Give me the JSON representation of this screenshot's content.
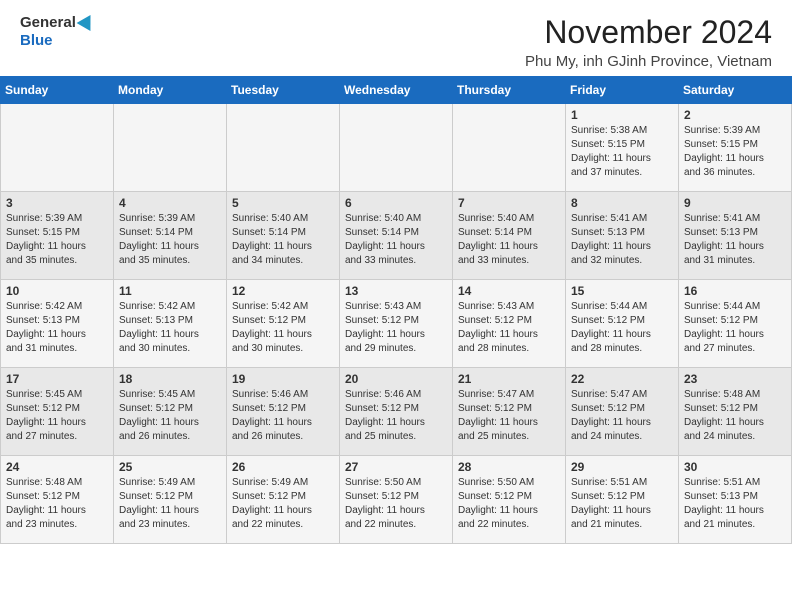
{
  "header": {
    "logo_general": "General",
    "logo_blue": "Blue",
    "month_title": "November 2024",
    "location": "Phu My, inh GJinh Province, Vietnam"
  },
  "calendar": {
    "days_of_week": [
      "Sunday",
      "Monday",
      "Tuesday",
      "Wednesday",
      "Thursday",
      "Friday",
      "Saturday"
    ],
    "weeks": [
      [
        {
          "day": "",
          "info": ""
        },
        {
          "day": "",
          "info": ""
        },
        {
          "day": "",
          "info": ""
        },
        {
          "day": "",
          "info": ""
        },
        {
          "day": "",
          "info": ""
        },
        {
          "day": "1",
          "info": "Sunrise: 5:38 AM\nSunset: 5:15 PM\nDaylight: 11 hours\nand 37 minutes."
        },
        {
          "day": "2",
          "info": "Sunrise: 5:39 AM\nSunset: 5:15 PM\nDaylight: 11 hours\nand 36 minutes."
        }
      ],
      [
        {
          "day": "3",
          "info": "Sunrise: 5:39 AM\nSunset: 5:15 PM\nDaylight: 11 hours\nand 35 minutes."
        },
        {
          "day": "4",
          "info": "Sunrise: 5:39 AM\nSunset: 5:14 PM\nDaylight: 11 hours\nand 35 minutes."
        },
        {
          "day": "5",
          "info": "Sunrise: 5:40 AM\nSunset: 5:14 PM\nDaylight: 11 hours\nand 34 minutes."
        },
        {
          "day": "6",
          "info": "Sunrise: 5:40 AM\nSunset: 5:14 PM\nDaylight: 11 hours\nand 33 minutes."
        },
        {
          "day": "7",
          "info": "Sunrise: 5:40 AM\nSunset: 5:14 PM\nDaylight: 11 hours\nand 33 minutes."
        },
        {
          "day": "8",
          "info": "Sunrise: 5:41 AM\nSunset: 5:13 PM\nDaylight: 11 hours\nand 32 minutes."
        },
        {
          "day": "9",
          "info": "Sunrise: 5:41 AM\nSunset: 5:13 PM\nDaylight: 11 hours\nand 31 minutes."
        }
      ],
      [
        {
          "day": "10",
          "info": "Sunrise: 5:42 AM\nSunset: 5:13 PM\nDaylight: 11 hours\nand 31 minutes."
        },
        {
          "day": "11",
          "info": "Sunrise: 5:42 AM\nSunset: 5:13 PM\nDaylight: 11 hours\nand 30 minutes."
        },
        {
          "day": "12",
          "info": "Sunrise: 5:42 AM\nSunset: 5:12 PM\nDaylight: 11 hours\nand 30 minutes."
        },
        {
          "day": "13",
          "info": "Sunrise: 5:43 AM\nSunset: 5:12 PM\nDaylight: 11 hours\nand 29 minutes."
        },
        {
          "day": "14",
          "info": "Sunrise: 5:43 AM\nSunset: 5:12 PM\nDaylight: 11 hours\nand 28 minutes."
        },
        {
          "day": "15",
          "info": "Sunrise: 5:44 AM\nSunset: 5:12 PM\nDaylight: 11 hours\nand 28 minutes."
        },
        {
          "day": "16",
          "info": "Sunrise: 5:44 AM\nSunset: 5:12 PM\nDaylight: 11 hours\nand 27 minutes."
        }
      ],
      [
        {
          "day": "17",
          "info": "Sunrise: 5:45 AM\nSunset: 5:12 PM\nDaylight: 11 hours\nand 27 minutes."
        },
        {
          "day": "18",
          "info": "Sunrise: 5:45 AM\nSunset: 5:12 PM\nDaylight: 11 hours\nand 26 minutes."
        },
        {
          "day": "19",
          "info": "Sunrise: 5:46 AM\nSunset: 5:12 PM\nDaylight: 11 hours\nand 26 minutes."
        },
        {
          "day": "20",
          "info": "Sunrise: 5:46 AM\nSunset: 5:12 PM\nDaylight: 11 hours\nand 25 minutes."
        },
        {
          "day": "21",
          "info": "Sunrise: 5:47 AM\nSunset: 5:12 PM\nDaylight: 11 hours\nand 25 minutes."
        },
        {
          "day": "22",
          "info": "Sunrise: 5:47 AM\nSunset: 5:12 PM\nDaylight: 11 hours\nand 24 minutes."
        },
        {
          "day": "23",
          "info": "Sunrise: 5:48 AM\nSunset: 5:12 PM\nDaylight: 11 hours\nand 24 minutes."
        }
      ],
      [
        {
          "day": "24",
          "info": "Sunrise: 5:48 AM\nSunset: 5:12 PM\nDaylight: 11 hours\nand 23 minutes."
        },
        {
          "day": "25",
          "info": "Sunrise: 5:49 AM\nSunset: 5:12 PM\nDaylight: 11 hours\nand 23 minutes."
        },
        {
          "day": "26",
          "info": "Sunrise: 5:49 AM\nSunset: 5:12 PM\nDaylight: 11 hours\nand 22 minutes."
        },
        {
          "day": "27",
          "info": "Sunrise: 5:50 AM\nSunset: 5:12 PM\nDaylight: 11 hours\nand 22 minutes."
        },
        {
          "day": "28",
          "info": "Sunrise: 5:50 AM\nSunset: 5:12 PM\nDaylight: 11 hours\nand 22 minutes."
        },
        {
          "day": "29",
          "info": "Sunrise: 5:51 AM\nSunset: 5:12 PM\nDaylight: 11 hours\nand 21 minutes."
        },
        {
          "day": "30",
          "info": "Sunrise: 5:51 AM\nSunset: 5:13 PM\nDaylight: 11 hours\nand 21 minutes."
        }
      ]
    ]
  }
}
